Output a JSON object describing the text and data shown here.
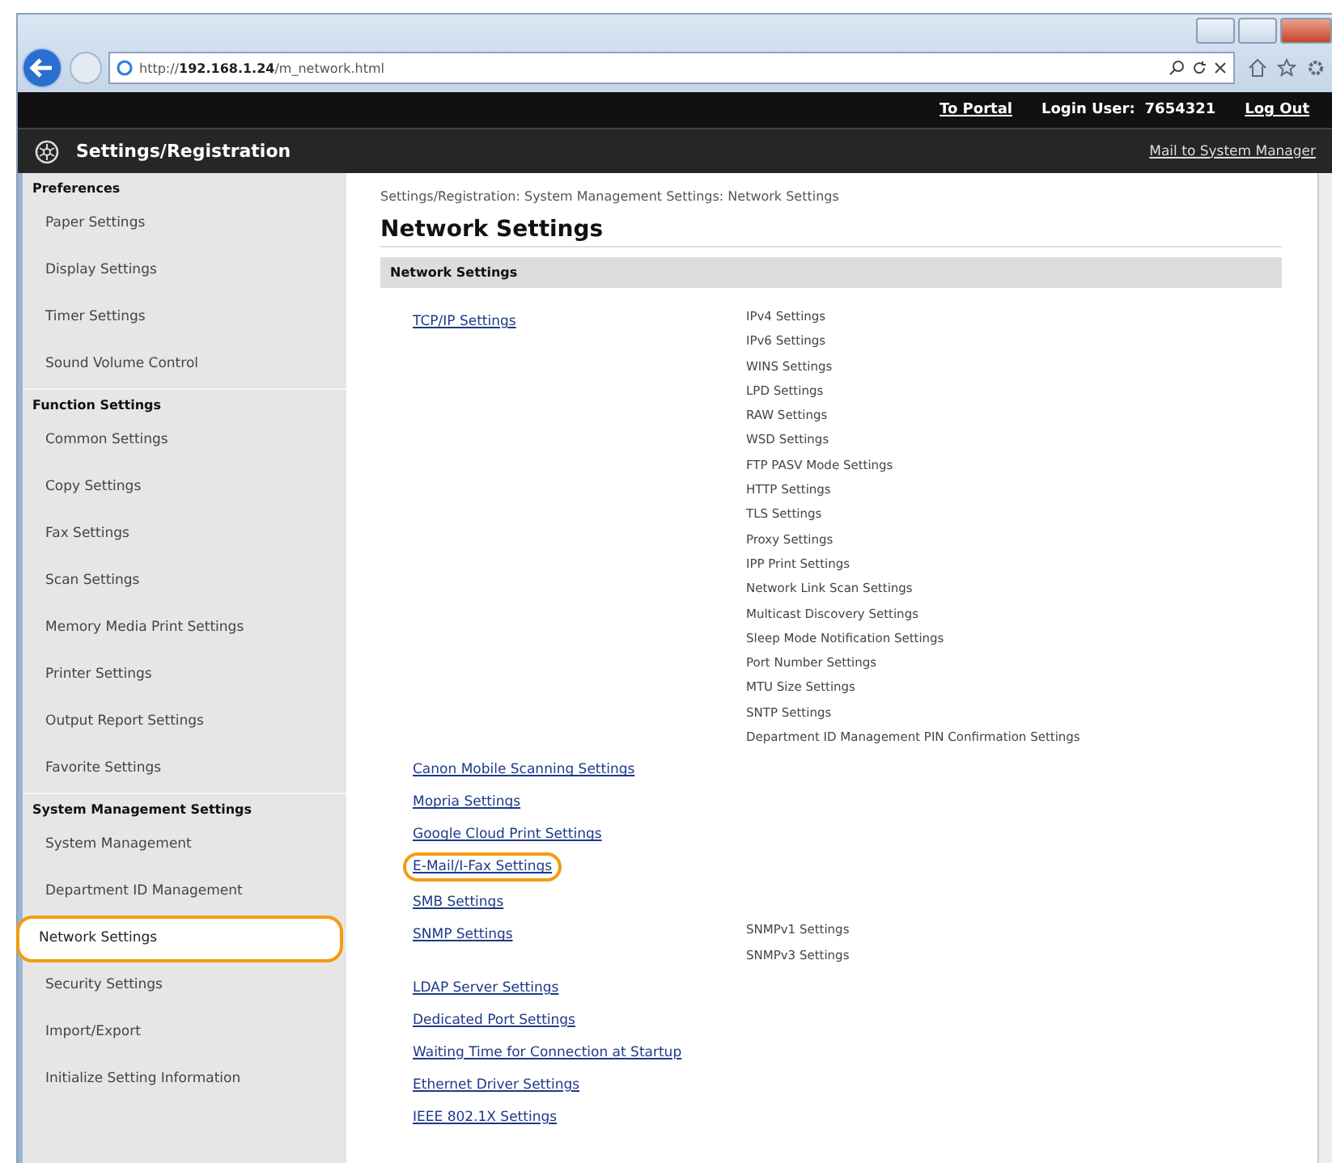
{
  "browser": {
    "url_prefix": "http://",
    "url_host": "192.168.1.24",
    "url_path": "/m_network.html"
  },
  "top_bar": {
    "portal_link": "To Portal",
    "login_label": "Login User:",
    "login_user": "7654321",
    "logout_link": "Log Out"
  },
  "header": {
    "title": "Settings/Registration",
    "mail_link": "Mail to System Manager"
  },
  "sidebar": {
    "sections": [
      {
        "title": "Preferences",
        "items": [
          {
            "label": "Paper Settings",
            "selected": false
          },
          {
            "label": "Display Settings",
            "selected": false
          },
          {
            "label": "Timer Settings",
            "selected": false
          },
          {
            "label": "Sound Volume Control",
            "selected": false
          }
        ]
      },
      {
        "title": "Function Settings",
        "items": [
          {
            "label": "Common Settings",
            "selected": false
          },
          {
            "label": "Copy Settings",
            "selected": false
          },
          {
            "label": "Fax Settings",
            "selected": false
          },
          {
            "label": "Scan Settings",
            "selected": false
          },
          {
            "label": "Memory Media Print Settings",
            "selected": false
          },
          {
            "label": "Printer Settings",
            "selected": false
          },
          {
            "label": "Output Report Settings",
            "selected": false
          },
          {
            "label": "Favorite Settings",
            "selected": false
          }
        ]
      },
      {
        "title": "System Management Settings",
        "items": [
          {
            "label": "System Management",
            "selected": false
          },
          {
            "label": "Department ID Management",
            "selected": false
          },
          {
            "label": "Network Settings",
            "selected": true
          },
          {
            "label": "Security Settings",
            "selected": false
          },
          {
            "label": "Import/Export",
            "selected": false
          },
          {
            "label": "Initialize Setting Information",
            "selected": false
          }
        ]
      }
    ]
  },
  "main": {
    "breadcrumb": "Settings/Registration: System Management Settings: Network Settings",
    "title": "Network Settings",
    "section_title": "Network Settings",
    "links": [
      {
        "label": "TCP/IP Settings",
        "highlighted": false,
        "subitems": [
          "IPv4 Settings",
          "IPv6 Settings",
          "WINS Settings",
          "LPD Settings",
          "RAW Settings",
          "WSD Settings",
          "FTP PASV Mode Settings",
          "HTTP Settings",
          "TLS Settings",
          "Proxy Settings",
          "IPP Print Settings",
          "Network Link Scan Settings",
          "Multicast Discovery Settings",
          "Sleep Mode Notification Settings",
          "Port Number Settings",
          "MTU Size Settings",
          "SNTP Settings",
          "Department ID Management PIN Confirmation Settings"
        ]
      },
      {
        "label": "Canon Mobile Scanning Settings",
        "highlighted": false
      },
      {
        "label": "Mopria Settings",
        "highlighted": false
      },
      {
        "label": "Google Cloud Print Settings",
        "highlighted": false
      },
      {
        "label": "E-Mail/I-Fax Settings",
        "highlighted": true
      },
      {
        "label": "SMB Settings",
        "highlighted": false
      },
      {
        "label": "SNMP Settings",
        "highlighted": false,
        "subitems": [
          "SNMPv1 Settings",
          "SNMPv3 Settings"
        ]
      },
      {
        "label": "LDAP Server Settings",
        "highlighted": false
      },
      {
        "label": "Dedicated Port Settings",
        "highlighted": false
      },
      {
        "label": "Waiting Time for Connection at Startup",
        "highlighted": false
      },
      {
        "label": "Ethernet Driver Settings",
        "highlighted": false
      },
      {
        "label": "IEEE 802.1X Settings",
        "highlighted": false
      }
    ]
  }
}
